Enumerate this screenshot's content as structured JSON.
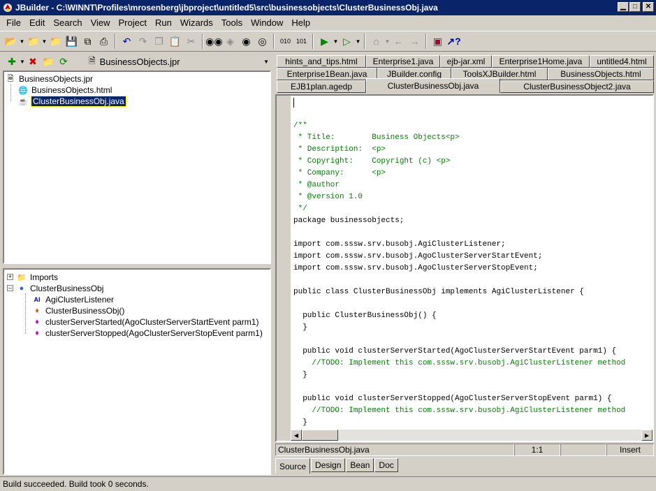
{
  "window": {
    "title": "JBuilder - C:\\WINNT\\Profiles\\mrosenberg\\jbproject\\untitled5\\src\\businessobjects\\ClusterBusinessObj.java"
  },
  "menu": [
    "File",
    "Edit",
    "Search",
    "View",
    "Project",
    "Run",
    "Wizards",
    "Tools",
    "Window",
    "Help"
  ],
  "project_combo": {
    "value": "BusinessObjects.jpr"
  },
  "project_tree": {
    "root": "BusinessObjects.jpr",
    "children": [
      "BusinessObjects.html",
      "ClusterBusinessObj.java"
    ]
  },
  "structure_tree": {
    "imports": "Imports",
    "class_name": "ClusterBusinessObj",
    "members": [
      "AgiClusterListener",
      "ClusterBusinessObj()",
      "clusterServerStarted(AgoClusterServerStartEvent parm1)",
      "clusterServerStopped(AgoClusterServerStopEvent parm1)"
    ]
  },
  "tabs": {
    "row1": [
      "hints_and_tips.html",
      "Enterprise1.java",
      "ejb-jar.xml",
      "Enterprise1Home.java",
      "untitled4.html"
    ],
    "row2": [
      "Enterprise1Bean.java",
      "JBuilder.config",
      "ToolsXJBuilder.html",
      "BusinessObjects.html"
    ],
    "row3": [
      "EJB1plan.agedp",
      "ClusterBusinessObj.java",
      "ClusterBusinessObject2.java"
    ]
  },
  "code_lines": [
    {
      "t": "",
      "c": ""
    },
    {
      "t": "/**",
      "c": "cm"
    },
    {
      "t": " * Title:        Business Objects<p>",
      "c": "cm"
    },
    {
      "t": " * Description:  <p>",
      "c": "cm"
    },
    {
      "t": " * Copyright:    Copyright (c) <p>",
      "c": "cm"
    },
    {
      "t": " * Company:      <p>",
      "c": "cm"
    },
    {
      "t": " * @author",
      "c": "cm"
    },
    {
      "t": " * @version 1.0",
      "c": "cm"
    },
    {
      "t": " */",
      "c": "cm"
    },
    {
      "t": "package businessobjects;",
      "c": ""
    },
    {
      "t": "",
      "c": ""
    },
    {
      "t": "import com.sssw.srv.busobj.AgiClusterListener;",
      "c": ""
    },
    {
      "t": "import com.sssw.srv.busobj.AgoClusterServerStartEvent;",
      "c": ""
    },
    {
      "t": "import com.sssw.srv.busobj.AgoClusterServerStopEvent;",
      "c": ""
    },
    {
      "t": "",
      "c": ""
    },
    {
      "t": "public class ClusterBusinessObj implements AgiClusterListener {",
      "c": ""
    },
    {
      "t": "",
      "c": ""
    },
    {
      "t": "  public ClusterBusinessObj() {",
      "c": ""
    },
    {
      "t": "  }",
      "c": ""
    },
    {
      "t": "",
      "c": ""
    },
    {
      "t": "  public void clusterServerStarted(AgoClusterServerStartEvent parm1) {",
      "c": ""
    },
    {
      "t": "    //TODO: Implement this com.sssw.srv.busobj.AgiClusterListener method",
      "c": "cm"
    },
    {
      "t": "  }",
      "c": ""
    },
    {
      "t": "",
      "c": ""
    },
    {
      "t": "  public void clusterServerStopped(AgoClusterServerStopEvent parm1) {",
      "c": ""
    },
    {
      "t": "    //TODO: Implement this com.sssw.srv.busobj.AgiClusterListener method",
      "c": "cm"
    },
    {
      "t": "  }",
      "c": ""
    },
    {
      "t": "}",
      "c": ""
    }
  ],
  "editor_status": {
    "file": "ClusterBusinessObj.java",
    "position": "1:1",
    "mode": "Insert"
  },
  "bottom_tabs": [
    "Source",
    "Design",
    "Bean",
    "Doc"
  ],
  "status_bar": "Build succeeded.  Build took 0 seconds.",
  "colors": {
    "title_bg": "#0a246a",
    "comment": "#008000",
    "face": "#d4d0c8"
  }
}
